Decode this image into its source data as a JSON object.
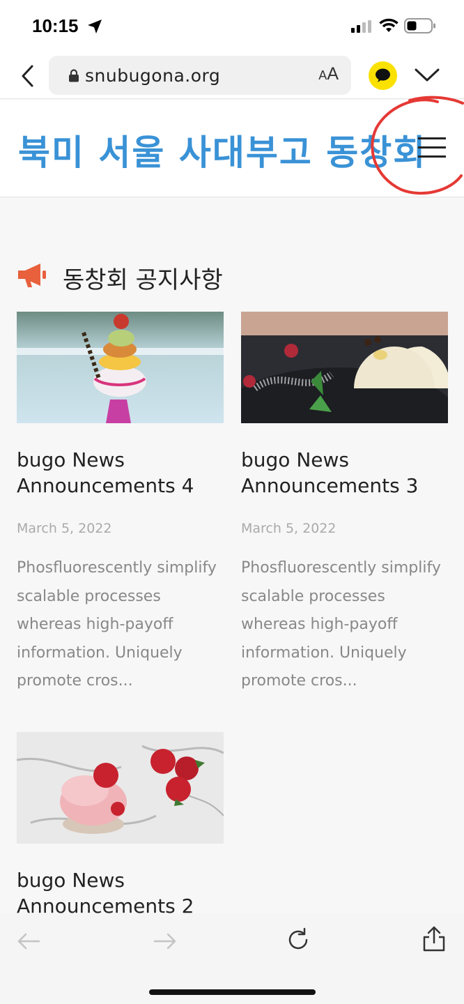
{
  "status_bar": {
    "time": "10:15"
  },
  "browser": {
    "url": "snubugona.org",
    "text_size_label_small": "A",
    "text_size_label_large": "A"
  },
  "site": {
    "logo_text": "북미 서울 사대부고 동창회"
  },
  "section": {
    "title": "동창회 공지사항"
  },
  "posts": [
    {
      "title": "bugo News Announcements 4",
      "date": "March 5, 2022",
      "excerpt": "Phosfluorescently simplify scalable processes whereas high-payoff information. Uniquely promote cros...",
      "image": "ice-cream-toy-photo"
    },
    {
      "title": "bugo News Announcements 3",
      "date": "March 5, 2022",
      "excerpt": "Phosfluorescently simplify scalable processes whereas high-payoff information. Uniquely promote cros...",
      "image": "panna-cotta-dessert-photo"
    },
    {
      "title": "bugo News Announcements 2",
      "image": "strawberry-dessert-photo"
    }
  ],
  "icons": {
    "location": "location-arrow-icon",
    "signal": "cellular-signal-icon",
    "wifi": "wifi-icon",
    "battery": "battery-icon",
    "lock": "lock-icon",
    "menu": "hamburger-menu-icon",
    "megaphone": "megaphone-icon"
  },
  "colors": {
    "logo": "#3a92d6",
    "megaphone": "#e8603c",
    "annotation_circle": "#e53935",
    "kakao": "#fae100"
  }
}
